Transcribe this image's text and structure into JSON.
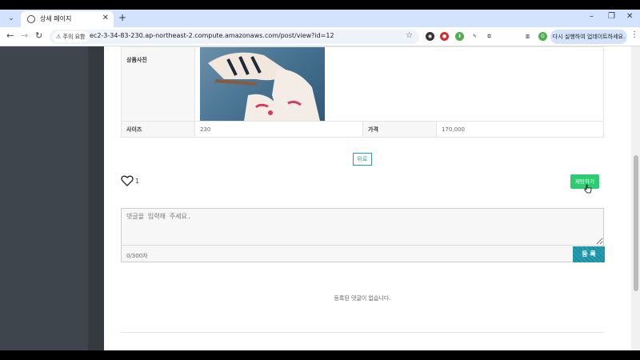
{
  "browser": {
    "tab_title": "상세 페이지",
    "new_tab_symbol": "+",
    "address_warning": "주의 요함",
    "url": "ec2-3-34-83-230.ap-northeast-2.compute.amazonaws.com/post/view?id=12",
    "update_label": "다시 실행하여 업데이트하세요.",
    "profile_initial": "G",
    "colors": {
      "tabbar": "#d3e3fd",
      "profile": "#4caf50"
    }
  },
  "detail": {
    "photo_label": "상품사진",
    "size_label": "사이즈",
    "size_value": "230",
    "price_label": "가격",
    "price_value": "170,000"
  },
  "actions": {
    "back_label": "뒤로",
    "like_count": "1",
    "report_label": "제탕하기"
  },
  "comment": {
    "placeholder": "댓글을 입력해 주세요.",
    "counter": "0/300자",
    "submit_label": "등 록",
    "empty_message": "등록된 댓글이 없습니다."
  },
  "colors": {
    "accent": "#2a9bb0",
    "report": "#2ecc71",
    "sidebar": "#3e454d"
  }
}
